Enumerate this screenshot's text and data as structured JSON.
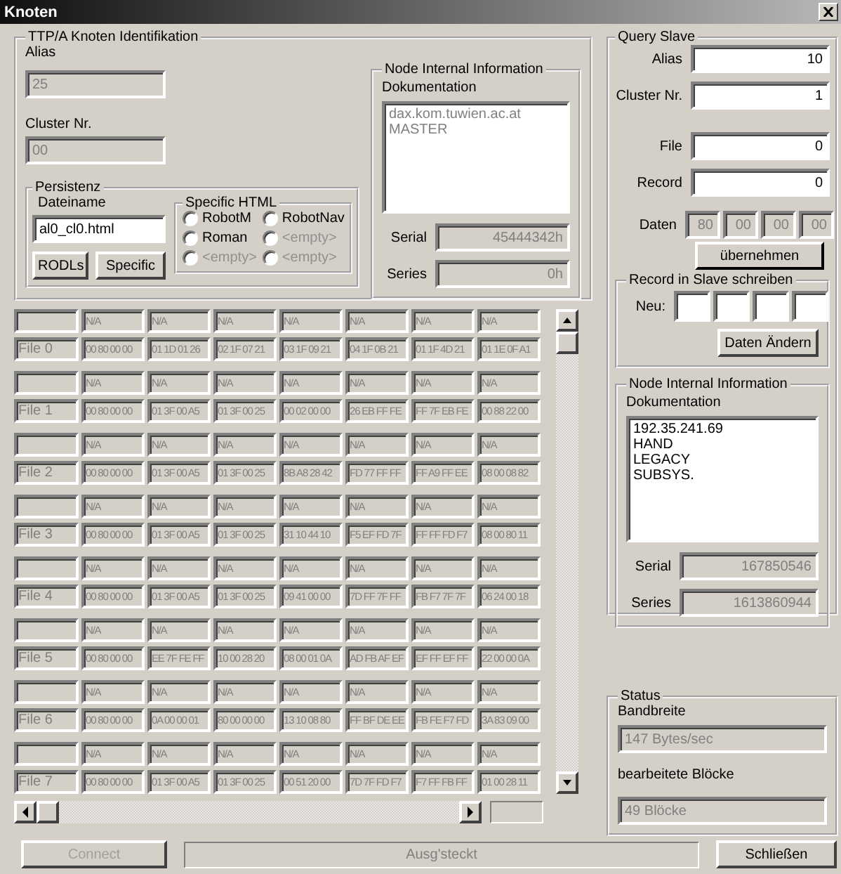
{
  "window": {
    "title": "Knoten"
  },
  "identification": {
    "title": "TTP/A Knoten Identifikation",
    "alias_label": "Alias",
    "alias": "25",
    "cluster_label": "Cluster Nr.",
    "cluster": "00",
    "persistence": {
      "title": "Persistenz",
      "filename_label": "Dateiname",
      "filename": "al0_cl0.html",
      "buttons": [
        "RODLs",
        "Specific"
      ]
    },
    "specific_html": {
      "title": "Specific HTML",
      "options": [
        {
          "label": "RobotM",
          "selected": false,
          "disabled": false
        },
        {
          "label": "RobotNav",
          "selected": false,
          "disabled": false
        },
        {
          "label": "Roman",
          "selected": false,
          "disabled": false
        },
        {
          "label": "<empty>",
          "selected": false,
          "disabled": true
        },
        {
          "label": "<empty>",
          "selected": false,
          "disabled": true
        },
        {
          "label": "<empty>",
          "selected": false,
          "disabled": true
        }
      ]
    }
  },
  "node_info": {
    "title": "Node Internal Information",
    "doc_label": "Dokumentation",
    "doc_lines": [
      "dax.kom.tuwien.ac.at",
      "MASTER"
    ],
    "disabled": true,
    "serial_label": "Serial",
    "serial": "45444342h",
    "series_label": "Series",
    "series": "0h"
  },
  "files": [
    {
      "label": "File 0",
      "upper": [
        "N/A",
        "N/A",
        "N/A",
        "N/A",
        "N/A",
        "N/A",
        "N/A"
      ],
      "values": [
        "00 80 00 00",
        "01 1D 01 26",
        "02 1F 07 21",
        "03 1F 09 21",
        "04 1F 0B 21",
        "01 1F 4D 21",
        "01 1E 0F A1"
      ]
    },
    {
      "label": "File 1",
      "upper": [
        "N/A",
        "N/A",
        "N/A",
        "N/A",
        "N/A",
        "N/A",
        "N/A"
      ],
      "values": [
        "00 80 00 00",
        "01 3F 00 A5",
        "01 3F 00 25",
        "00 02 00 00",
        "26 EB FF FE",
        "FF 7F EB FE",
        "00 88 22 00"
      ]
    },
    {
      "label": "File 2",
      "upper": [
        "N/A",
        "N/A",
        "N/A",
        "N/A",
        "N/A",
        "N/A",
        "N/A"
      ],
      "values": [
        "00 80 00 00",
        "01 3F 00 A5",
        "01 3F 00 25",
        "8B A8 28 42",
        "FD 77 FF FF",
        "FF A9 FF EE",
        "08 00 08 82"
      ]
    },
    {
      "label": "File 3",
      "upper": [
        "N/A",
        "N/A",
        "N/A",
        "N/A",
        "N/A",
        "N/A",
        "N/A"
      ],
      "values": [
        "00 80 00 00",
        "01 3F 00 A5",
        "01 3F 00 25",
        "31 10 44 10",
        "F5 EF FD 7F",
        "FF FF FD F7",
        "08 00 80 11"
      ]
    },
    {
      "label": "File 4",
      "upper": [
        "N/A",
        "N/A",
        "N/A",
        "N/A",
        "N/A",
        "N/A",
        "N/A"
      ],
      "values": [
        "00 80 00 00",
        "01 3F 00 A5",
        "01 3F 00 25",
        "09 41 00 00",
        "7D FF 7F FF",
        "FB F7 7F 7F",
        "06 24 00 18"
      ]
    },
    {
      "label": "File 5",
      "upper": [
        "N/A",
        "N/A",
        "N/A",
        "N/A",
        "N/A",
        "N/A",
        "N/A"
      ],
      "values": [
        "00 80 00 00",
        "EE 7F FE FF",
        "10 00 28 20",
        "08 00 01 0A",
        "AD FB AF EF",
        "EF FF EF FF",
        "22 00 00 0A"
      ]
    },
    {
      "label": "File 6",
      "upper": [
        "N/A",
        "N/A",
        "N/A",
        "N/A",
        "N/A",
        "N/A",
        "N/A"
      ],
      "values": [
        "00 80 00 00",
        "0A 00 00 01",
        "80 00 00 00",
        "13 10 08 80",
        "FF BF DE EE",
        "FB FE F7 FD",
        "3A 83 09 00"
      ]
    },
    {
      "label": "File 7",
      "upper": [
        "N/A",
        "N/A",
        "N/A",
        "N/A",
        "N/A",
        "N/A",
        "N/A"
      ],
      "values": [
        "00 80 00 00",
        "01 3F 00 A5",
        "01 3F 00 25",
        "00 51 20 00",
        "7D 7F FD F7",
        "F7 FF FB FF",
        "01 00 28 11"
      ]
    }
  ],
  "query_slave": {
    "title": "Query Slave",
    "fields": [
      {
        "label": "Alias",
        "value": "10"
      },
      {
        "label": "Cluster Nr.",
        "value": "1"
      },
      {
        "label": "File",
        "value": "0"
      },
      {
        "label": "Record",
        "value": "0"
      }
    ],
    "data_label": "Daten",
    "data": [
      "80",
      "00",
      "00",
      "00"
    ],
    "apply_button": "übernehmen",
    "write": {
      "title": "Record in Slave schreiben",
      "new_label": "Neu:",
      "change_button": "Daten Ändern"
    },
    "node_info": {
      "title": "Node Internal Information",
      "doc_label": "Dokumentation",
      "doc_lines": [
        "192.35.241.69",
        "HAND",
        "LEGACY",
        "SUBSYS."
      ],
      "disabled": false,
      "serial_label": "Serial",
      "serial": "167850546",
      "series_label": "Series",
      "series": "1613860944"
    }
  },
  "status": {
    "title": "Status",
    "bandwidth_label": "Bandbreite",
    "bandwidth": "147 Bytes/sec",
    "blocks_label": "bearbeitete Blöcke",
    "blocks": "49 Blöcke"
  },
  "footer": {
    "connect": {
      "label": "Connect",
      "disabled": true
    },
    "status_text": "Ausg'steckt",
    "close_button": "Schließen"
  }
}
